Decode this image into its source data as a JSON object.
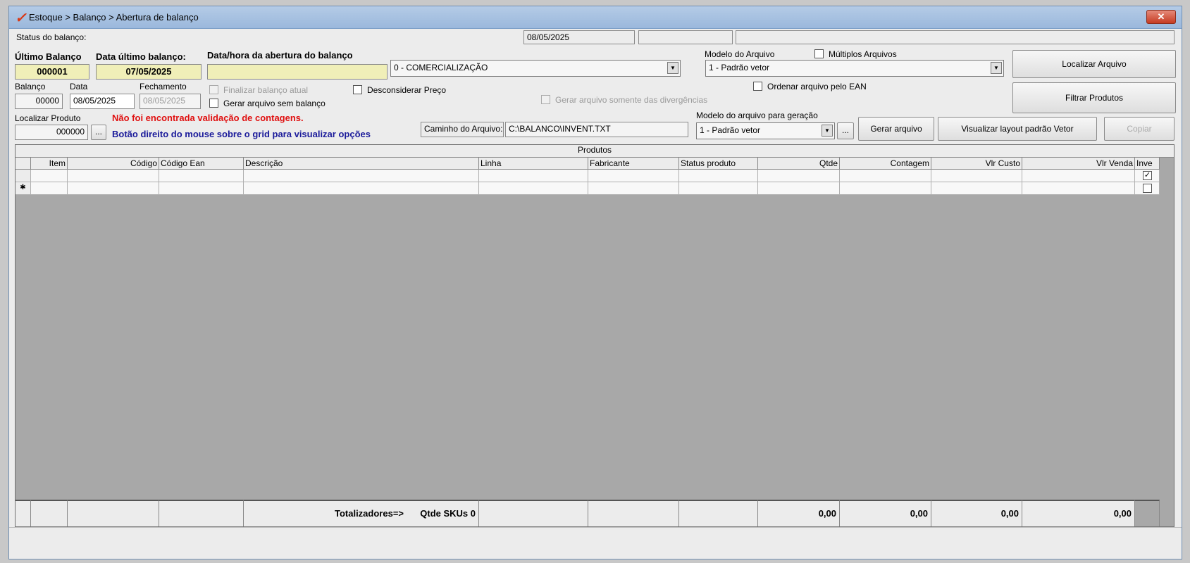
{
  "window": {
    "title": "Estoque > Balanço > Abertura de balanço",
    "close": "✕"
  },
  "status": {
    "label": "Status do balanço:",
    "date": "08/05/2025",
    "field2": "",
    "field3": ""
  },
  "last_balance": {
    "label": "Último Balanço",
    "value": "000001"
  },
  "last_date": {
    "label": "Data último balanço:",
    "value": "07/05/2025"
  },
  "open_datetime": {
    "label": "Data/hora da abertura do balanço",
    "value": ""
  },
  "type_select": {
    "value": "0 - COMERCIALIZAÇÃO"
  },
  "file_model": {
    "label": "Modelo do Arquivo",
    "value": "1 - Padrão vetor"
  },
  "multiple_files": {
    "label": "Múltiplos Arquivos",
    "checked": false
  },
  "balance": {
    "label": "Balanço",
    "value": "00000"
  },
  "date": {
    "label": "Data",
    "value": "08/05/2025"
  },
  "closing": {
    "label": "Fechamento",
    "value": "08/05/2025"
  },
  "finalize_current": {
    "label": "Finalizar balanço atual",
    "checked": false
  },
  "no_balance_file": {
    "label": "Gerar arquivo sem balanço",
    "checked": false
  },
  "ignore_price": {
    "label": "Desconsiderar Preço",
    "checked": false
  },
  "divergences_only": {
    "label": "Gerar arquivo somente das divergências",
    "checked": false
  },
  "order_ean": {
    "label": "Ordenar arquivo pelo EAN",
    "checked": false
  },
  "find_product": {
    "label": "Localizar Produto",
    "value": "000000",
    "browse": "..."
  },
  "msg_validation": "Não foi encontrada validação de contagens.",
  "msg_hint": "Botão direito do mouse sobre o grid para visualizar opções",
  "file_path": {
    "label": "Caminho do Arquivo:",
    "value": "C:\\BALANCO\\INVENT.TXT"
  },
  "gen_model": {
    "label": "Modelo do arquivo para geração",
    "value": "1 - Padrão vetor",
    "browse": "..."
  },
  "buttons": {
    "locate_file": "Localizar Arquivo",
    "filter_products": "Filtrar Produtos",
    "generate_file": "Gerar arquivo",
    "view_layout": "Visualizar layout padrão Vetor",
    "copy": "Copiar"
  },
  "grid": {
    "caption": "Produtos",
    "columns": [
      "Item",
      "Código",
      "Código Ean",
      "Descrição",
      "Linha",
      "Fabricante",
      "Status produto",
      "Qtde",
      "Contagem",
      "Vlr Custo",
      "Vlr Venda",
      "Inve"
    ],
    "rows": [
      {
        "indicator": "",
        "inve_checked": true
      },
      {
        "indicator": "✱",
        "inve_checked": false
      }
    ],
    "totals": {
      "label": "Totalizadores=>",
      "skus": "Qtde SKUs 0",
      "qtde": "0,00",
      "contagem": "0,00",
      "vlr_custo": "0,00",
      "vlr_venda": "0,00"
    }
  }
}
